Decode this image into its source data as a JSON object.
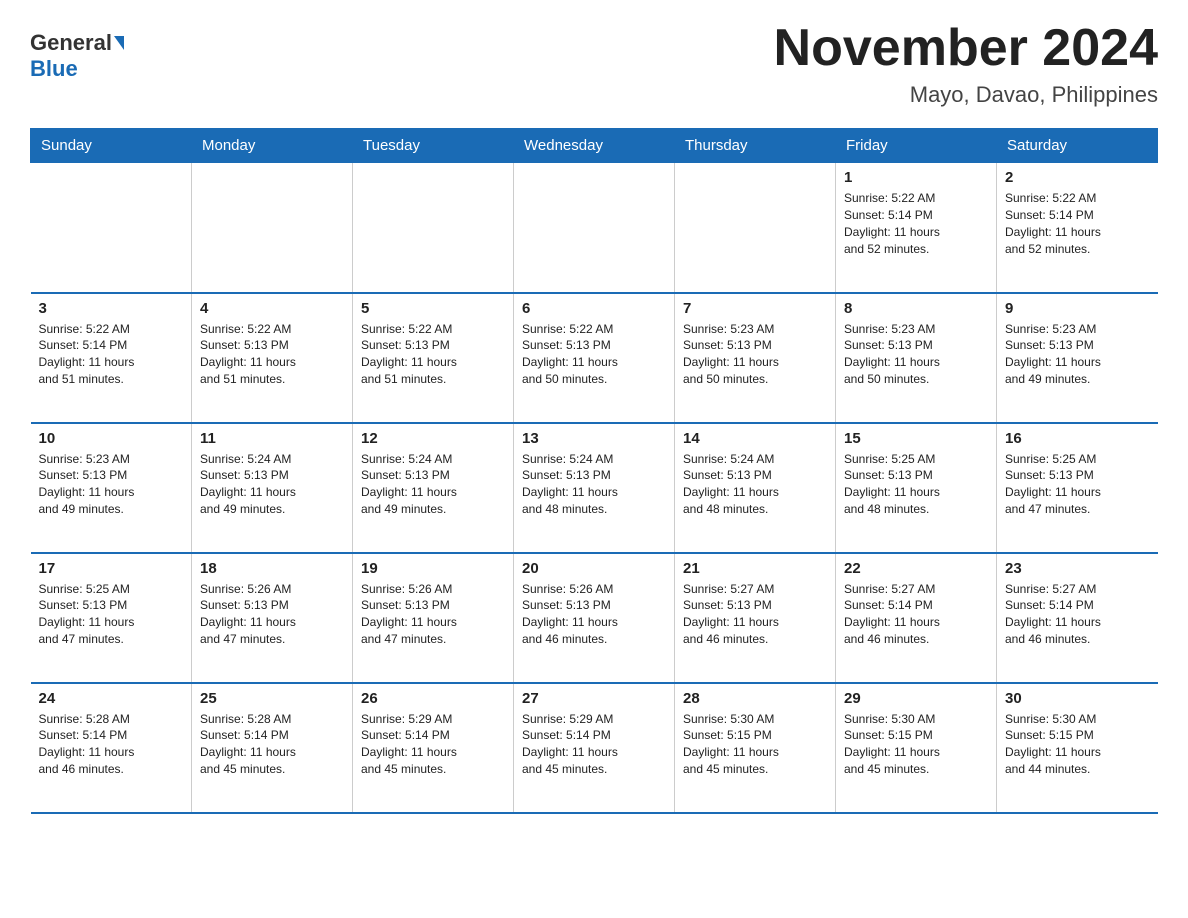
{
  "header": {
    "logo_general": "General",
    "logo_blue": "Blue",
    "title": "November 2024",
    "subtitle": "Mayo, Davao, Philippines"
  },
  "weekdays": [
    "Sunday",
    "Monday",
    "Tuesday",
    "Wednesday",
    "Thursday",
    "Friday",
    "Saturday"
  ],
  "rows": [
    [
      {
        "day": "",
        "info": ""
      },
      {
        "day": "",
        "info": ""
      },
      {
        "day": "",
        "info": ""
      },
      {
        "day": "",
        "info": ""
      },
      {
        "day": "",
        "info": ""
      },
      {
        "day": "1",
        "info": "Sunrise: 5:22 AM\nSunset: 5:14 PM\nDaylight: 11 hours\nand 52 minutes."
      },
      {
        "day": "2",
        "info": "Sunrise: 5:22 AM\nSunset: 5:14 PM\nDaylight: 11 hours\nand 52 minutes."
      }
    ],
    [
      {
        "day": "3",
        "info": "Sunrise: 5:22 AM\nSunset: 5:14 PM\nDaylight: 11 hours\nand 51 minutes."
      },
      {
        "day": "4",
        "info": "Sunrise: 5:22 AM\nSunset: 5:13 PM\nDaylight: 11 hours\nand 51 minutes."
      },
      {
        "day": "5",
        "info": "Sunrise: 5:22 AM\nSunset: 5:13 PM\nDaylight: 11 hours\nand 51 minutes."
      },
      {
        "day": "6",
        "info": "Sunrise: 5:22 AM\nSunset: 5:13 PM\nDaylight: 11 hours\nand 50 minutes."
      },
      {
        "day": "7",
        "info": "Sunrise: 5:23 AM\nSunset: 5:13 PM\nDaylight: 11 hours\nand 50 minutes."
      },
      {
        "day": "8",
        "info": "Sunrise: 5:23 AM\nSunset: 5:13 PM\nDaylight: 11 hours\nand 50 minutes."
      },
      {
        "day": "9",
        "info": "Sunrise: 5:23 AM\nSunset: 5:13 PM\nDaylight: 11 hours\nand 49 minutes."
      }
    ],
    [
      {
        "day": "10",
        "info": "Sunrise: 5:23 AM\nSunset: 5:13 PM\nDaylight: 11 hours\nand 49 minutes."
      },
      {
        "day": "11",
        "info": "Sunrise: 5:24 AM\nSunset: 5:13 PM\nDaylight: 11 hours\nand 49 minutes."
      },
      {
        "day": "12",
        "info": "Sunrise: 5:24 AM\nSunset: 5:13 PM\nDaylight: 11 hours\nand 49 minutes."
      },
      {
        "day": "13",
        "info": "Sunrise: 5:24 AM\nSunset: 5:13 PM\nDaylight: 11 hours\nand 48 minutes."
      },
      {
        "day": "14",
        "info": "Sunrise: 5:24 AM\nSunset: 5:13 PM\nDaylight: 11 hours\nand 48 minutes."
      },
      {
        "day": "15",
        "info": "Sunrise: 5:25 AM\nSunset: 5:13 PM\nDaylight: 11 hours\nand 48 minutes."
      },
      {
        "day": "16",
        "info": "Sunrise: 5:25 AM\nSunset: 5:13 PM\nDaylight: 11 hours\nand 47 minutes."
      }
    ],
    [
      {
        "day": "17",
        "info": "Sunrise: 5:25 AM\nSunset: 5:13 PM\nDaylight: 11 hours\nand 47 minutes."
      },
      {
        "day": "18",
        "info": "Sunrise: 5:26 AM\nSunset: 5:13 PM\nDaylight: 11 hours\nand 47 minutes."
      },
      {
        "day": "19",
        "info": "Sunrise: 5:26 AM\nSunset: 5:13 PM\nDaylight: 11 hours\nand 47 minutes."
      },
      {
        "day": "20",
        "info": "Sunrise: 5:26 AM\nSunset: 5:13 PM\nDaylight: 11 hours\nand 46 minutes."
      },
      {
        "day": "21",
        "info": "Sunrise: 5:27 AM\nSunset: 5:13 PM\nDaylight: 11 hours\nand 46 minutes."
      },
      {
        "day": "22",
        "info": "Sunrise: 5:27 AM\nSunset: 5:14 PM\nDaylight: 11 hours\nand 46 minutes."
      },
      {
        "day": "23",
        "info": "Sunrise: 5:27 AM\nSunset: 5:14 PM\nDaylight: 11 hours\nand 46 minutes."
      }
    ],
    [
      {
        "day": "24",
        "info": "Sunrise: 5:28 AM\nSunset: 5:14 PM\nDaylight: 11 hours\nand 46 minutes."
      },
      {
        "day": "25",
        "info": "Sunrise: 5:28 AM\nSunset: 5:14 PM\nDaylight: 11 hours\nand 45 minutes."
      },
      {
        "day": "26",
        "info": "Sunrise: 5:29 AM\nSunset: 5:14 PM\nDaylight: 11 hours\nand 45 minutes."
      },
      {
        "day": "27",
        "info": "Sunrise: 5:29 AM\nSunset: 5:14 PM\nDaylight: 11 hours\nand 45 minutes."
      },
      {
        "day": "28",
        "info": "Sunrise: 5:30 AM\nSunset: 5:15 PM\nDaylight: 11 hours\nand 45 minutes."
      },
      {
        "day": "29",
        "info": "Sunrise: 5:30 AM\nSunset: 5:15 PM\nDaylight: 11 hours\nand 45 minutes."
      },
      {
        "day": "30",
        "info": "Sunrise: 5:30 AM\nSunset: 5:15 PM\nDaylight: 11 hours\nand 44 minutes."
      }
    ]
  ]
}
